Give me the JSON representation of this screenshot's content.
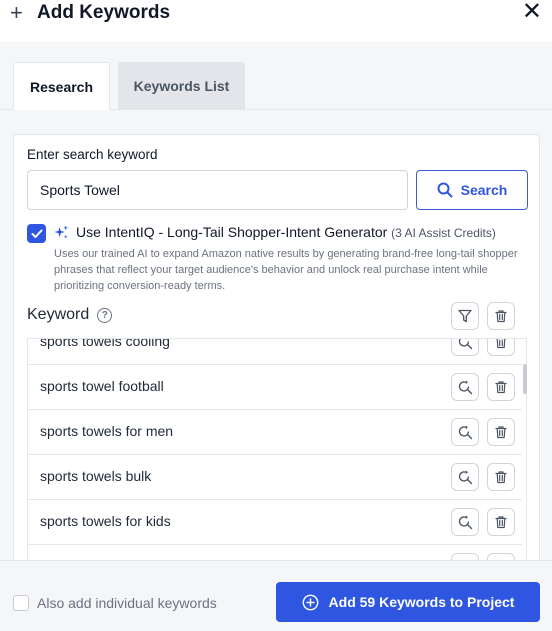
{
  "header": {
    "title": "Add Keywords",
    "plus_glyph": "+",
    "close_glyph": "✕"
  },
  "tabs": [
    {
      "label": "Research",
      "active": true
    },
    {
      "label": "Keywords List",
      "active": false
    }
  ],
  "search": {
    "label": "Enter search keyword",
    "value": "Sports Towel",
    "button_label": "Search"
  },
  "intentiq": {
    "checked": true,
    "title": "Use IntentIQ - Long-Tail Shopper-Intent Generator",
    "credits": "(3 AI Assist Credits)",
    "description": "Uses our trained AI to expand Amazon native results by generating brand-free long-tail shopper phrases that reflect your target audience's behavior and unlock real purchase intent while prioritizing conversion-ready terms."
  },
  "keyword_list": {
    "header": "Keyword",
    "help_glyph": "?",
    "items": [
      "sports towels cooling",
      "sports towel football",
      "sports towels for men",
      "sports towels bulk",
      "sports towels for kids",
      ""
    ]
  },
  "footer": {
    "also_add_label": "Also add individual keywords",
    "also_add_checked": false,
    "add_button_label": "Add 59 Keywords to Project"
  },
  "colors": {
    "accent": "#2f56e0",
    "panel_bg": "#f5f6f8",
    "border": "#e5e7eb"
  },
  "icons": [
    "plus-icon",
    "close-icon",
    "search-icon",
    "check-icon",
    "sparkle-icon",
    "help-icon",
    "filter-icon",
    "trash-icon",
    "search-refresh-icon",
    "plus-circle-icon"
  ]
}
